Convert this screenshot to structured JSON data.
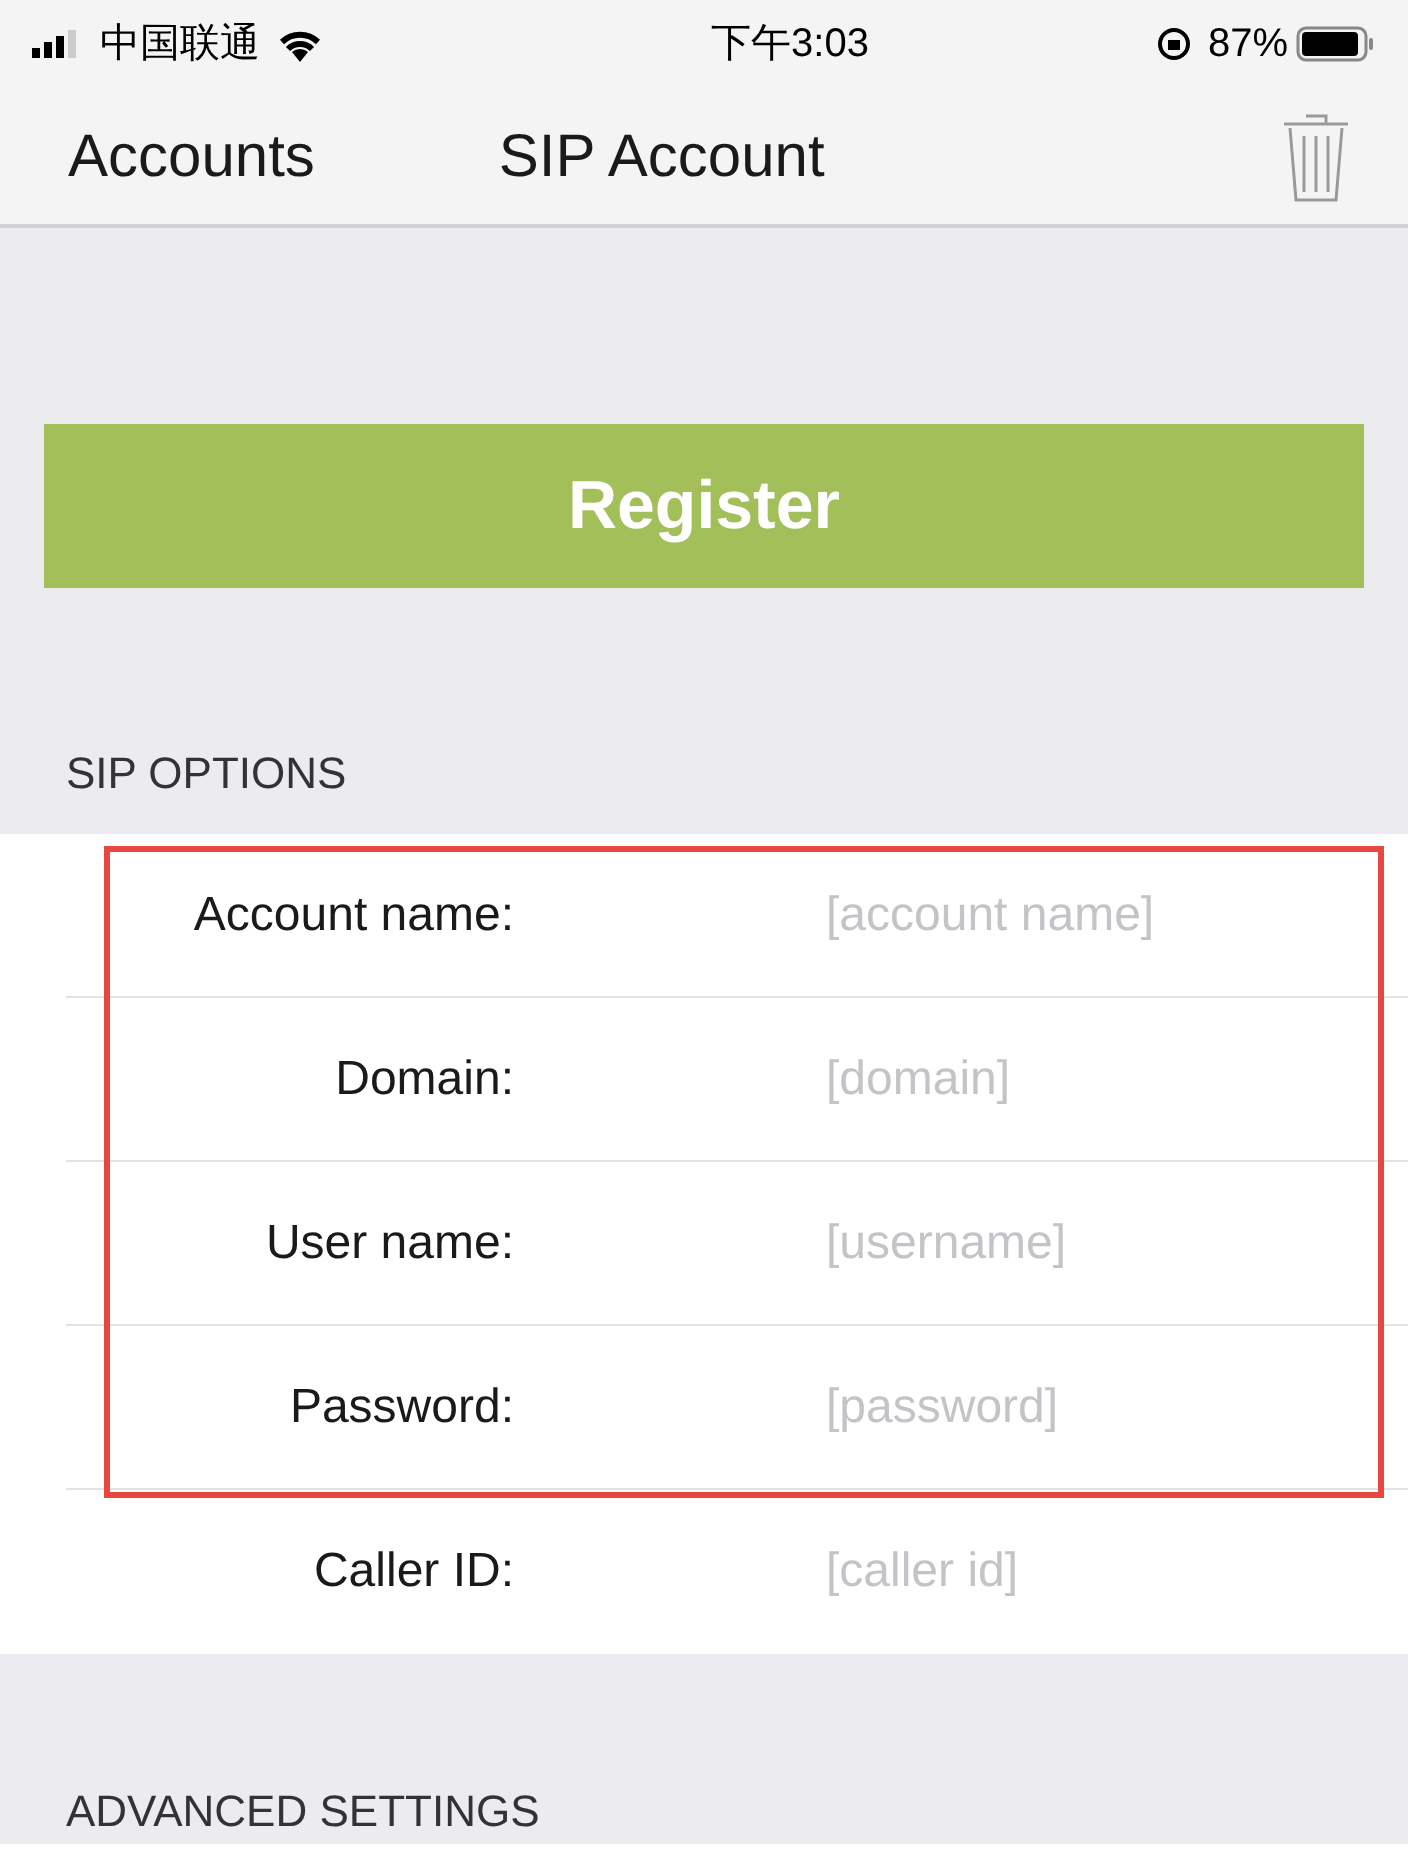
{
  "status_bar": {
    "carrier": "中国联通",
    "time": "下午3:03",
    "battery": "87%"
  },
  "nav": {
    "back": "Accounts",
    "title": "SIP Account"
  },
  "register_button": "Register",
  "sections": [
    {
      "header": "SIP OPTIONS",
      "rows": [
        {
          "label": "Account name:",
          "placeholder": "[account name]",
          "highlighted": true
        },
        {
          "label": "Domain:",
          "placeholder": "[domain]",
          "highlighted": true
        },
        {
          "label": "User name:",
          "placeholder": "[username]",
          "highlighted": true
        },
        {
          "label": "Password:",
          "placeholder": "[password]",
          "highlighted": true
        },
        {
          "label": "Caller ID:",
          "placeholder": "[caller id]",
          "highlighted": false
        }
      ]
    },
    {
      "header": "ADVANCED SETTINGS"
    }
  ]
}
